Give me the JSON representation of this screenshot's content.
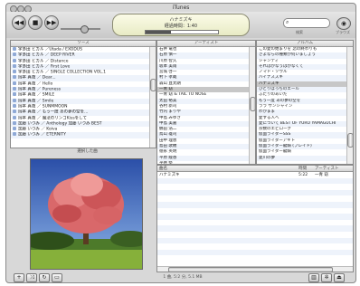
{
  "window": {
    "title": "iTunes"
  },
  "player": {
    "now_playing_title": "ハナミズキ",
    "elapsed_label": "経過時間：1:40",
    "progress_fraction": 0.35,
    "volume_fraction": 0.6
  },
  "toolbar": {
    "prev_icon": "previous-icon",
    "play_icon": "play-icon",
    "next_icon": "next-icon",
    "search_label": "検索",
    "browse_label": "ブラウズ"
  },
  "browser": {
    "genre_header": "ソース",
    "artist_header": "アーティスト",
    "album_header": "アルバム",
    "sources": [
      "宇多田 ヒカル ／Utada / EXODUS",
      "宇多田 ヒカル ／ DEEP RIVER",
      "宇多田 ヒカル ／ Distance",
      "宇多田 ヒカル ／ First Love",
      "宇多田 ヒカル ／ SINGLE COLLECTION VOL.1",
      "岡本 真夜 ／ Dear...",
      "岡本 真夜 ／ Hello",
      "岡本 真夜 ／ Pureness",
      "岡本 真夜 ／ SMILE",
      "岡本 真夜 ／ Smile",
      "岡本 真夜 ／ SUNMMOON",
      "岡本 真夜 ／ もう一度 あの夢の空を...",
      "岡本 真夜 ／ 魔法のリンゴKissをして",
      "加藤 いづみ ／ Anthology 加藤 いづみ BEST",
      "加藤 いづみ ／ Koiva",
      "加藤 いづみ ／ ETERNITY"
    ],
    "artists": [
      "石井 竜也",
      "石原 慎一",
      "川原 智久",
      "坂本 美雨",
      "宮城 啓一",
      "村下 孝蔵",
      "森山 直太朗",
      "一青 窈",
      "一青 窈 & TAIL TO NOSE",
      "太田 裕美",
      "谷村 新司",
      "竹内 まりや",
      "中島 みゆき",
      "中島 美嘉",
      "鶴田 浩二",
      "鳥山 雄司",
      "田中 理恵",
      "島田 歌穂",
      "徳永 英明",
      "平原 綾香",
      "平井 堅",
      "本多 千春"
    ],
    "albums": [
      "この愛の始まりを 恋の終わりも",
      "さよならの種類が何いましょう",
      "シャンディ",
      "それはかなうはかなくて",
      "ノマド・ソウル",
      "ハイナスズキ",
      "ハナミズキ",
      "ひとりぼっちのエール",
      "ふたりのあいだ",
      "もう一度 あの夢の空を",
      "ララ サンシャイン",
      "わがまま",
      "愛する人へ",
      "愛について BEST OF YURO YAMAGUCHI",
      "宗数のエピローグ",
      "仮面ライダーSSS",
      "仮面ライダーアギト",
      "仮面ライダー龍騎 (ブレイド)",
      "仮面ライダー龍騎",
      "夏川の夢"
    ],
    "selected_artist_index": 7,
    "selected_album_index": 6
  },
  "artwork": {
    "header": "選択した曲"
  },
  "songs": {
    "headers": {
      "name": "曲名",
      "time": "時間",
      "artist": "アーティスト"
    },
    "rows": [
      {
        "name": "ハナミズキ",
        "time": "5:22",
        "artist": "一青 窈"
      }
    ]
  },
  "status": {
    "text": "1 曲, 5:2 分, 5.1 MB"
  },
  "bottom_controls": {
    "add_icon": "plus-icon",
    "shuffle_icon": "shuffle-icon",
    "repeat_icon": "repeat-icon",
    "burn_icon": "burn-icon",
    "visualizer_icon": "visualizer-icon",
    "eject_icon": "eject-icon"
  }
}
